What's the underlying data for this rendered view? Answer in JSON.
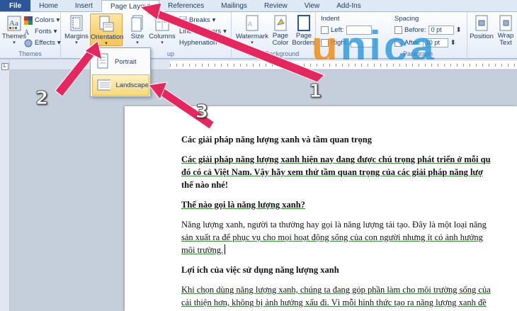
{
  "tabs": [
    "File",
    "Home",
    "Insert",
    "Page Layout",
    "References",
    "Mailings",
    "Review",
    "View",
    "Add-Ins"
  ],
  "active_tab": "Page Layout",
  "themes_group": {
    "themes_label": "Themes",
    "colors_label": "Colors",
    "fonts_label": "Fonts",
    "effects_label": "Effects",
    "group_label": "Themes"
  },
  "page_setup_group": {
    "margins_label": "Margins",
    "orientation_label": "Orientation",
    "size_label": "Size",
    "columns_label": "Columns",
    "breaks_label": "Breaks",
    "line_numbers_label": "Line Numbers",
    "hyphenation_label": "Hyphenation",
    "group_label_fragment": "up"
  },
  "page_background_group": {
    "watermark_label": "Watermark",
    "page_color_label": "Page Color",
    "page_borders_label": "Page Borders",
    "group_label": "Page Background"
  },
  "paragraph_group": {
    "indent_label": "Indent",
    "left_label": "Left:",
    "right_label": "Right:",
    "spacing_label": "Spacing",
    "before_label": "Before:",
    "before_value": "0 pt",
    "after_label": "After:",
    "after_value": "10 pt",
    "group_label": "Paragraph"
  },
  "arrange_group": {
    "position_label": "Position",
    "wrap_text_label": "Wrap Text"
  },
  "orientation_menu": {
    "portrait_label": "Portrait",
    "landscape_label": "Landscape"
  },
  "annotations": {
    "n1": "1",
    "n2": "2",
    "n3": "3",
    "arrow_color": "#e8265e"
  },
  "watermark_logo": "unica",
  "document": {
    "heading": "Các giải pháp năng lượng xanh và tầm quan trọng",
    "intro_line1": "Các giải pháp năng lượng xanh hiện nay đang được chú trọng phát triển ở mỗi qu",
    "intro_line2": "đó có cả Việt Nam. Vậy hãy xem thử tầm quan trọng của các giải pháp năng lượ",
    "intro_line3": "thế nào nhé!",
    "q1": "Thế nào gọi là năng lượng xanh?",
    "p1_line1": "Năng lượng xanh, người ta thường hay gọi là năng lượng tái tạo. Đây là một loại năng",
    "p1_line2": "sản xuất ra để phục vụ cho mọi hoạt động sống của con người nhưng ít có ảnh hưởng",
    "p1_line3": "môi trường.",
    "q2": "Lợi ích của việc sử dụng năng lượng xanh",
    "p2_line1": "Khi chọn dùng năng lượng xanh, chúng ta đang góp phần làm cho môi trường sống của",
    "p2_line2": "cải thiện hơn, không bị ảnh hưởng xấu đi. Vì mỗi hình thức tạo ra năng lượng xanh đề"
  }
}
